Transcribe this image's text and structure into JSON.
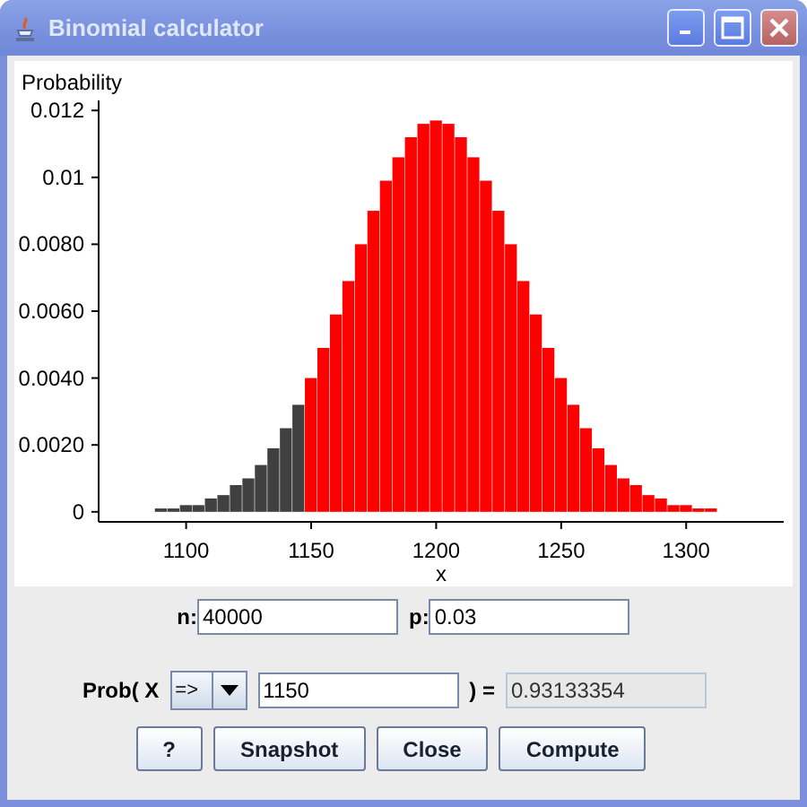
{
  "window": {
    "title": "Binomial calculator"
  },
  "chart": {
    "chart_data": {
      "type": "bar",
      "ylabel": "Probability",
      "xlabel": "x",
      "x": [
        1075,
        1080,
        1085,
        1090,
        1095,
        1100,
        1105,
        1110,
        1115,
        1120,
        1125,
        1130,
        1135,
        1140,
        1145,
        1150,
        1155,
        1160,
        1165,
        1170,
        1175,
        1180,
        1185,
        1190,
        1195,
        1200,
        1205,
        1210,
        1215,
        1220,
        1225,
        1230,
        1235,
        1240,
        1245,
        1250,
        1255,
        1260,
        1265,
        1270,
        1275,
        1280,
        1285,
        1290,
        1295,
        1300,
        1305,
        1310,
        1315,
        1320,
        1325,
        1330
      ],
      "series": [
        {
          "color": "#404040",
          "values": [
            0.0,
            0.0,
            0.0,
            0.0001,
            0.0001,
            0.0002,
            0.0002,
            0.0004,
            0.0005,
            0.0008,
            0.001,
            0.0014,
            0.0019,
            0.0025,
            0.0032,
            null,
            null,
            null,
            null,
            null,
            null,
            null,
            null,
            null,
            null,
            null,
            null,
            null,
            null,
            null,
            null,
            null,
            null,
            null,
            null,
            null,
            null,
            null,
            null,
            null,
            null,
            null,
            null,
            null,
            null,
            null,
            null,
            null,
            null,
            null,
            null,
            null
          ]
        },
        {
          "color": "#ff0000",
          "values": [
            null,
            null,
            null,
            null,
            null,
            null,
            null,
            null,
            null,
            null,
            null,
            null,
            null,
            null,
            null,
            0.004,
            0.0049,
            0.0059,
            0.0069,
            0.008,
            0.009,
            0.0099,
            0.0106,
            0.0112,
            0.0116,
            0.0117,
            0.0116,
            0.0112,
            0.0106,
            0.0099,
            0.009,
            0.008,
            0.0069,
            0.0059,
            0.0049,
            0.004,
            0.0032,
            0.0025,
            0.0019,
            0.0014,
            0.001,
            0.0008,
            0.0005,
            0.0004,
            0.0002,
            0.0002,
            0.0001,
            0.0001,
            0.0,
            0.0,
            0.0,
            0.0
          ]
        }
      ],
      "xlim": [
        1065,
        1339
      ],
      "ylim": [
        -0.0003,
        0.0123
      ],
      "xticks": [
        1100,
        1150,
        1200,
        1250,
        1300
      ],
      "yticks": [
        {
          "value": 0,
          "label": "0"
        },
        {
          "value": 0.002,
          "label": "0.0020"
        },
        {
          "value": 0.004,
          "label": "0.0040"
        },
        {
          "value": 0.006,
          "label": "0.0060"
        },
        {
          "value": 0.008,
          "label": "0.0080"
        },
        {
          "value": 0.01,
          "label": "0.01"
        },
        {
          "value": 0.012,
          "label": "0.012"
        }
      ]
    }
  },
  "params": [
    {
      "label": "n:",
      "value": "40000"
    },
    {
      "label": "p:",
      "value": "0.03"
    }
  ],
  "prob": {
    "label": "Prob( X",
    "operator": "=>",
    "value": "1150",
    "equals": ") =",
    "result": "0.93133354",
    "result_editable": false
  },
  "buttons": [
    "?",
    "Snapshot",
    "Close",
    "Compute"
  ]
}
